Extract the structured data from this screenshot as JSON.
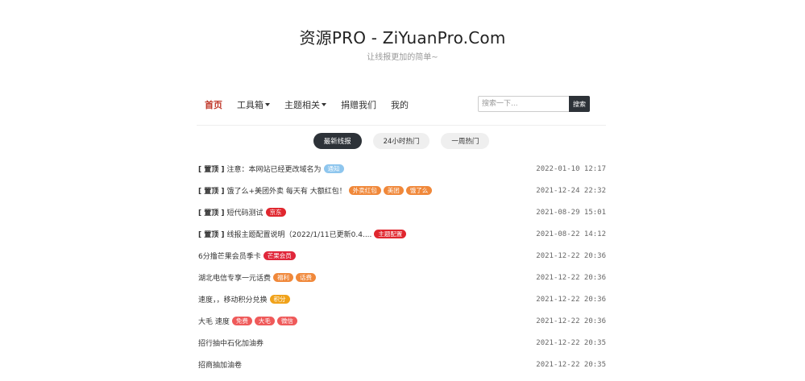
{
  "site": {
    "title": "资源PRO - ZiYuanPro.Com",
    "subtitle": "让线报更加的简单~"
  },
  "nav": {
    "items": [
      {
        "label": "首页",
        "active": true,
        "dropdown": false
      },
      {
        "label": "工具箱",
        "active": false,
        "dropdown": true
      },
      {
        "label": "主题相关",
        "active": false,
        "dropdown": true
      },
      {
        "label": "捐赠我们",
        "active": false,
        "dropdown": false
      },
      {
        "label": "我的",
        "active": false,
        "dropdown": false
      }
    ],
    "search": {
      "placeholder": "搜索一下...",
      "button_label": "搜索"
    }
  },
  "tabs": [
    {
      "label": "最新线报",
      "active": true
    },
    {
      "label": "24小时热门",
      "active": false
    },
    {
      "label": "一周热门",
      "active": false
    }
  ],
  "posts": [
    {
      "pin": "[ 置顶 ]",
      "title": "注意：本网站已经更改域名为",
      "tags": [
        {
          "label": "通知",
          "color": "#8ec6ee"
        }
      ],
      "date": "2022-01-10 12:17"
    },
    {
      "pin": "[ 置顶 ]",
      "title": "饿了么+美团外卖 每天有 大额红包！",
      "tags": [
        {
          "label": "外卖红包",
          "color": "#f0883a"
        },
        {
          "label": "美团",
          "color": "#f0883a"
        },
        {
          "label": "饿了么",
          "color": "#f0883a"
        }
      ],
      "date": "2021-12-24 22:32"
    },
    {
      "pin": "[ 置顶 ]",
      "title": "短代码测试",
      "tags": [
        {
          "label": "京东",
          "color": "#e0262e"
        }
      ],
      "date": "2021-08-29 15:01"
    },
    {
      "pin": "[ 置顶 ]",
      "title": "线报主题配置说明（2022/1/11已更新0.4....",
      "tags": [
        {
          "label": "主题配置",
          "color": "#e0262e"
        }
      ],
      "date": "2021-08-22 14:12"
    },
    {
      "pin": "",
      "title": "6分撸芒果会员季卡",
      "tags": [
        {
          "label": "芒果会员",
          "color": "#e0263a"
        }
      ],
      "date": "2021-12-22 20:36"
    },
    {
      "pin": "",
      "title": "湖北电信专享一元话费",
      "tags": [
        {
          "label": "福利",
          "color": "#f0883a"
        },
        {
          "label": "话费",
          "color": "#f0883a"
        }
      ],
      "date": "2021-12-22 20:36"
    },
    {
      "pin": "",
      "title": "速度，，移动积分兑换",
      "tags": [
        {
          "label": "积分",
          "color": "#f0a21a"
        }
      ],
      "date": "2021-12-22 20:36"
    },
    {
      "pin": "",
      "title": "大毛 速度",
      "tags": [
        {
          "label": "免费",
          "color": "#ef5a5a"
        },
        {
          "label": "大毛",
          "color": "#ef5a5a"
        },
        {
          "label": "微信",
          "color": "#ef5a5a"
        }
      ],
      "date": "2021-12-22 20:36"
    },
    {
      "pin": "",
      "title": "招行抽中石化加油券",
      "tags": [],
      "date": "2021-12-22 20:35"
    },
    {
      "pin": "",
      "title": "招商抽加油卷",
      "tags": [],
      "date": "2021-12-22 20:35"
    }
  ]
}
